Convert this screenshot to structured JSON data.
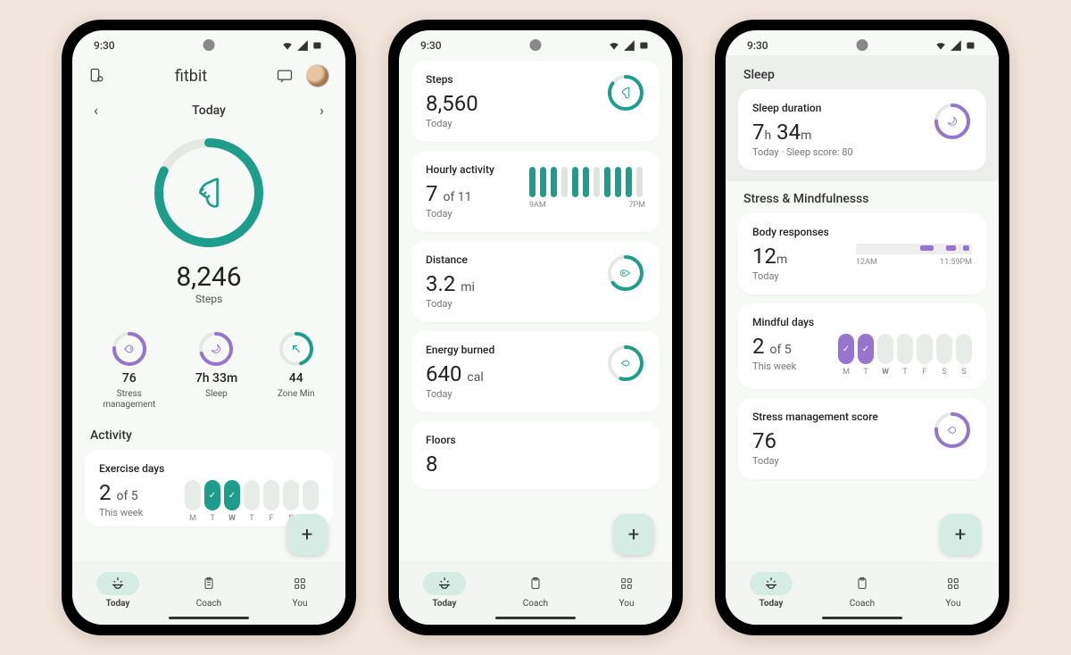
{
  "status": {
    "time": "9:30"
  },
  "colors": {
    "teal": "#1e9e8a",
    "purple": "#9575cd",
    "track": "#e4e9e4"
  },
  "nav": {
    "items": [
      {
        "label": "Today",
        "icon": "today"
      },
      {
        "label": "Coach",
        "icon": "clipboard"
      },
      {
        "label": "You",
        "icon": "grid"
      }
    ]
  },
  "screen1": {
    "brand": "fitbit",
    "date_label": "Today",
    "hero": {
      "value": "8,246",
      "label": "Steps",
      "progress": 0.82
    },
    "minis": [
      {
        "value": "76",
        "label": "Stress\nmanagement",
        "color": "purple",
        "icon": "stress",
        "progress": 0.76
      },
      {
        "value": "7h 33m",
        "label": "Sleep",
        "color": "purple",
        "icon": "moon",
        "progress": 0.7
      },
      {
        "value": "44",
        "label": "Zone Min",
        "color": "teal",
        "icon": "arrow",
        "progress": 0.45
      }
    ],
    "activity_header": "Activity",
    "exercise": {
      "title": "Exercise days",
      "value": "2",
      "of": "of 5",
      "sub": "This week",
      "days": [
        "M",
        "T",
        "W",
        "T",
        "F",
        "S",
        "S"
      ],
      "done": [
        false,
        true,
        true,
        false,
        false,
        false,
        false
      ]
    }
  },
  "screen2": {
    "steps": {
      "title": "Steps",
      "value": "8,560",
      "sub": "Today",
      "progress": 0.85
    },
    "hourly": {
      "title": "Hourly activity",
      "value": "7",
      "of": "of 11",
      "sub": "Today",
      "bars": [
        1,
        1,
        1,
        0,
        1,
        1,
        0,
        1,
        1,
        1,
        0
      ],
      "start": "9AM",
      "end": "7PM"
    },
    "distance": {
      "title": "Distance",
      "value": "3.2",
      "unit": "mi",
      "sub": "Today",
      "progress": 0.65
    },
    "energy": {
      "title": "Energy burned",
      "value": "640",
      "unit": "cal",
      "sub": "Today",
      "progress": 0.55
    },
    "floors": {
      "title": "Floors",
      "value": "8"
    }
  },
  "screen3": {
    "sleep_header": "Sleep",
    "sleep": {
      "title": "Sleep duration",
      "hours": "7",
      "h": "h",
      "mins": "34",
      "m": "m",
      "sub": "Today · Sleep score: 80",
      "progress": 0.75
    },
    "stress_header": "Stress & Mindfulnesss",
    "body": {
      "title": "Body responses",
      "value": "12",
      "unit": "m",
      "sub": "Today",
      "start": "12AM",
      "end": "11:59PM"
    },
    "mindful": {
      "title": "Mindful days",
      "value": "2",
      "of": "of 5",
      "sub": "This week",
      "days": [
        "M",
        "T",
        "W",
        "T",
        "F",
        "S",
        "S"
      ],
      "done": [
        true,
        true,
        false,
        false,
        false,
        false,
        false
      ]
    },
    "stress_score": {
      "title": "Stress management score",
      "value": "76",
      "sub": "Today",
      "progress": 0.76
    }
  }
}
